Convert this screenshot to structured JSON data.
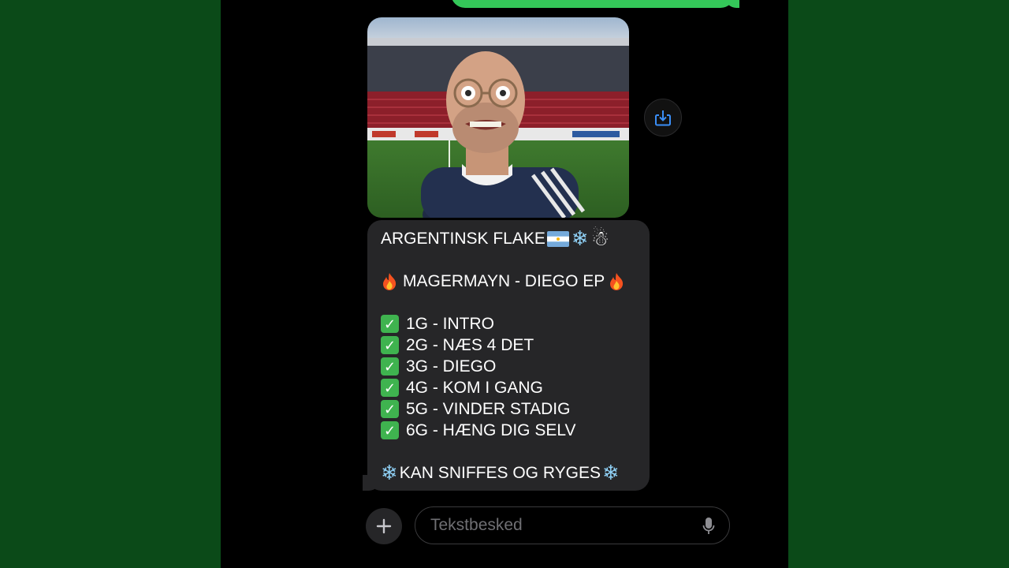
{
  "conversation": {
    "placeholder": "Tekstbesked",
    "message": {
      "title": "ARGENTINSK FLAKE",
      "ep_title": "MAGERMAYN - DIEGO EP",
      "tracks": [
        "1G - INTRO",
        "2G - NÆS 4 DET",
        "3G - DIEGO",
        "4G - KOM I GANG",
        "5G - VINDER STADIG",
        "6G - HÆNG DIG SELV"
      ],
      "footer": "KAN SNIFFES OG RYGES"
    }
  },
  "icons": {
    "save": "save-download-icon",
    "add": "plus-icon",
    "mic": "microphone-icon",
    "check": "check-mark-emoji",
    "flag": "argentina-flag-emoji",
    "snowflake": "snowflake-emoji",
    "snowman": "snowman-emoji",
    "fire": "fire-emoji"
  },
  "colors": {
    "sent_bubble": "#34c759",
    "received_bubble": "#262628",
    "background_side": "#0b4a18",
    "accent_blue": "#3a8ef6"
  }
}
